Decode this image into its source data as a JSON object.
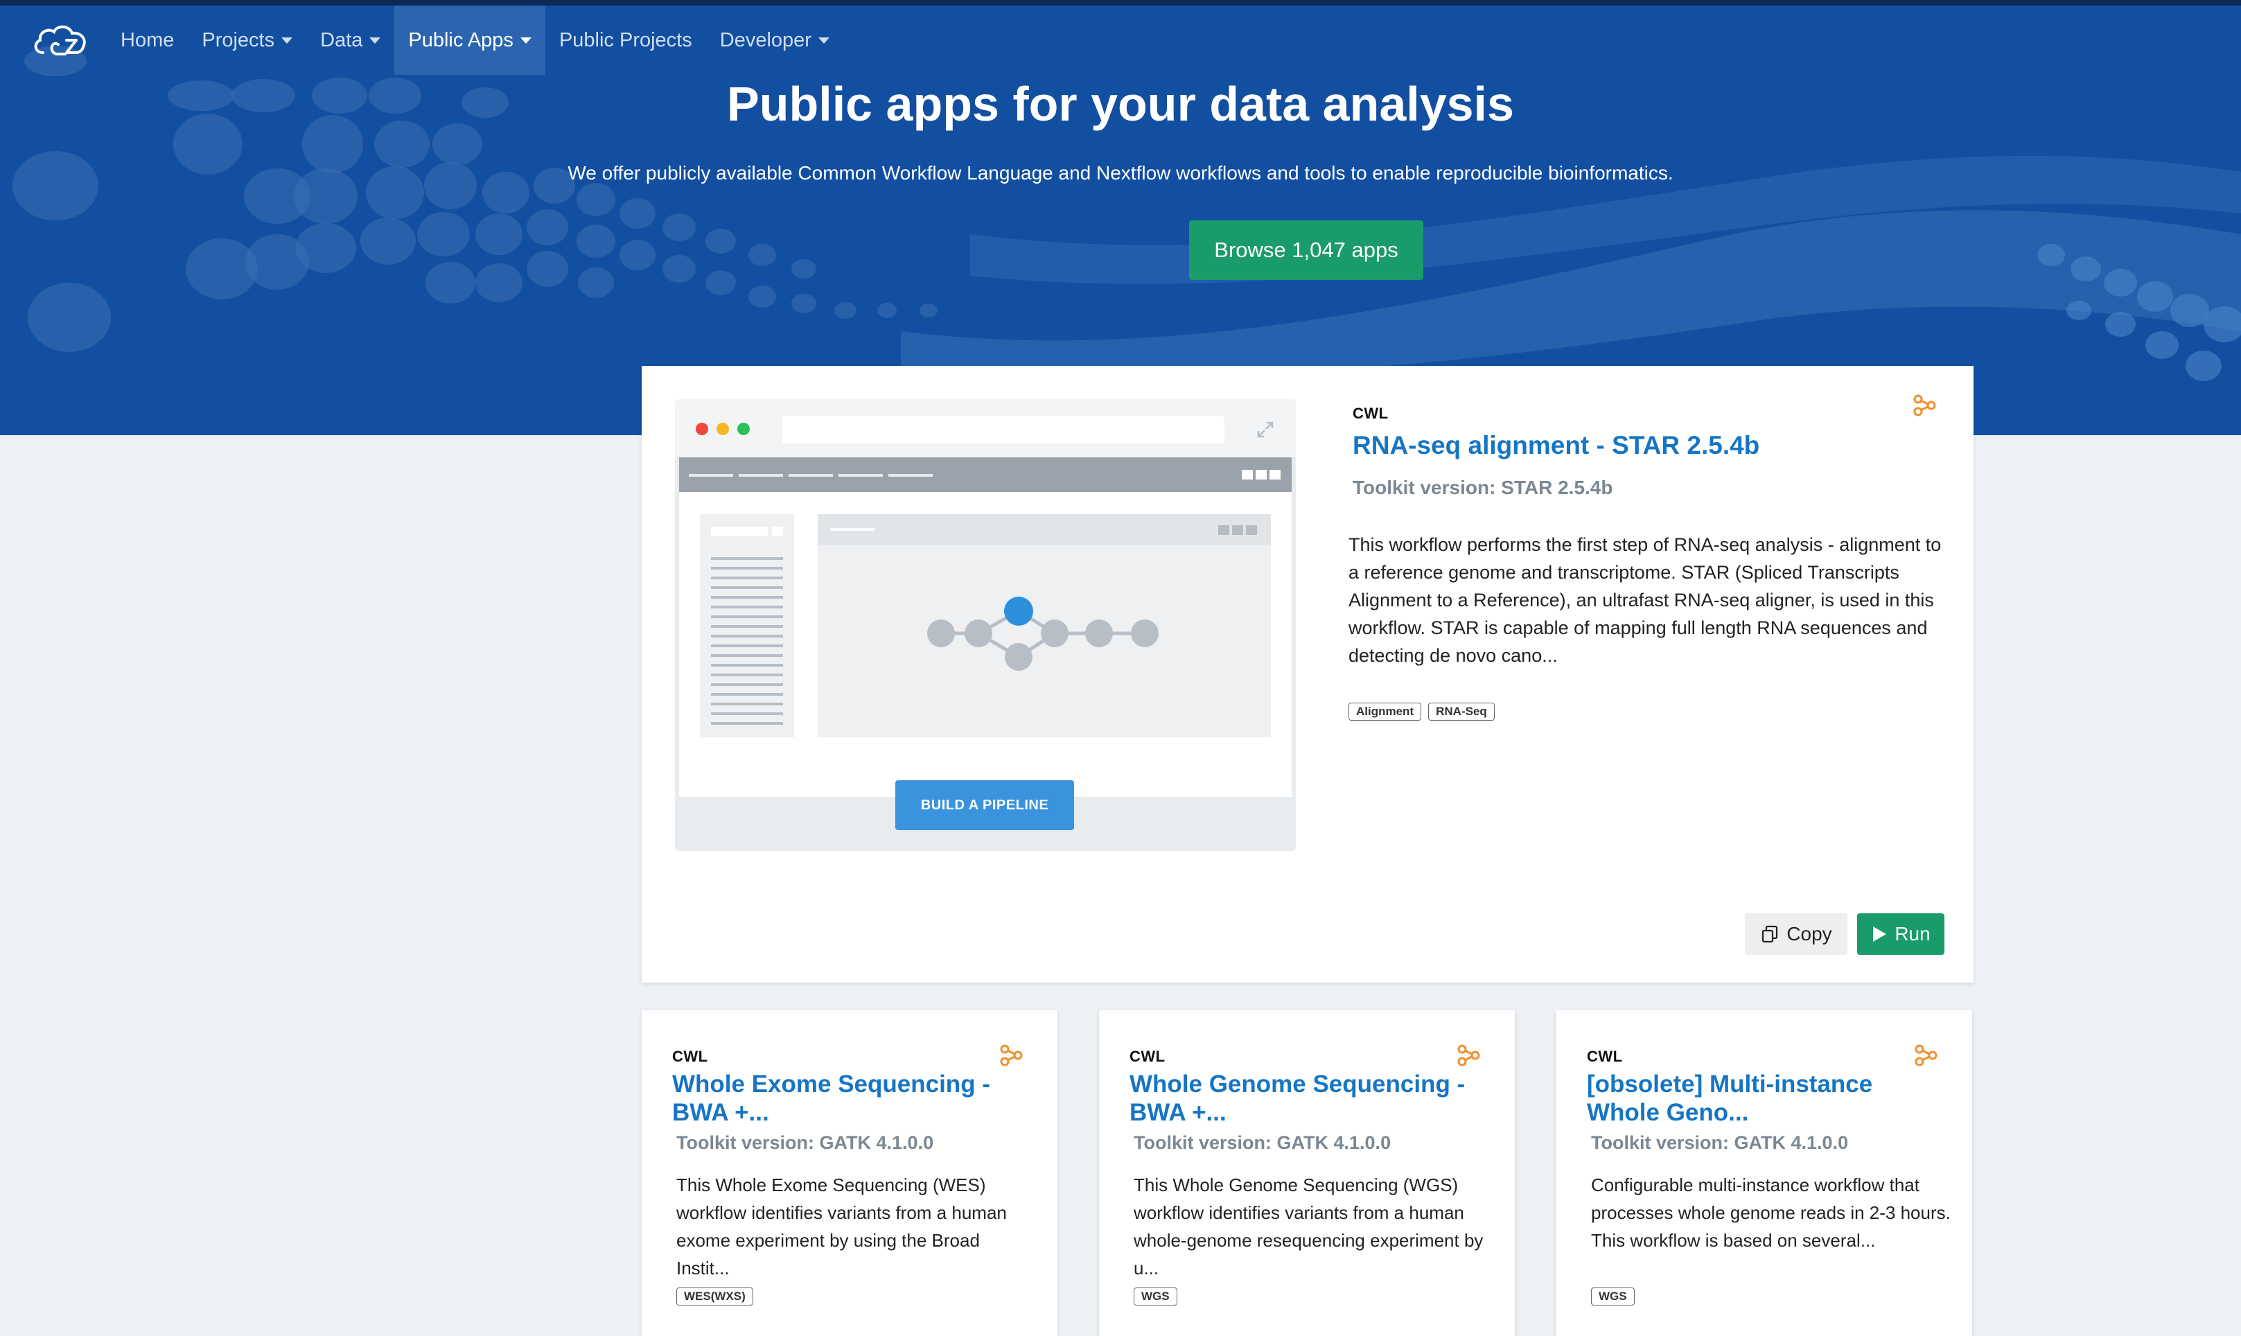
{
  "nav": {
    "items": [
      {
        "label": "Home",
        "dropdown": false
      },
      {
        "label": "Projects",
        "dropdown": true
      },
      {
        "label": "Data",
        "dropdown": true
      },
      {
        "label": "Public Apps",
        "dropdown": true,
        "active": true
      },
      {
        "label": "Public Projects",
        "dropdown": false
      },
      {
        "label": "Developer",
        "dropdown": true
      }
    ],
    "logo_icon": "cloud-logo-icon"
  },
  "hero": {
    "title": "Public apps for your data analysis",
    "subtitle": "We offer publicly available Common Workflow Language and Nextflow workflows and tools to enable reproducible bioinformatics.",
    "browse_label": "Browse 1,047 apps"
  },
  "featured": {
    "illustration_button": "BUILD A PIPELINE",
    "lang": "CWL",
    "title": "RNA-seq alignment - STAR 2.5.4b",
    "toolkit": "Toolkit version: STAR 2.5.4b",
    "description": "This workflow performs the first step of RNA-seq analysis - alignment to a reference genome and transcriptome. STAR (Spliced Transcripts Alignment to a Reference), an ultrafast RNA-seq aligner, is used in this workflow. STAR is capable of mapping full length RNA sequences and detecting de novo cano...",
    "tags": [
      "Alignment",
      "RNA-Seq"
    ],
    "copy_label": "Copy",
    "run_label": "Run"
  },
  "cards": [
    {
      "lang": "CWL",
      "title": "Whole Exome Sequencing - BWA +...",
      "toolkit": "Toolkit version: GATK 4.1.0.0",
      "description": "This Whole Exome Sequencing (WES) workflow identifies variants from a human exome experiment by using the Broad Instit...",
      "tags": [
        "WES(WXS)"
      ]
    },
    {
      "lang": "CWL",
      "title": "Whole Genome Sequencing - BWA +...",
      "toolkit": "Toolkit version: GATK 4.1.0.0",
      "description": "This Whole Genome Sequencing (WGS) workflow identifies variants from a human whole-genome resequencing experiment by u...",
      "tags": [
        "WGS"
      ]
    },
    {
      "lang": "CWL",
      "title": "[obsolete] Multi-instance Whole Geno...",
      "toolkit": "Toolkit version: GATK 4.1.0.0",
      "description": "Configurable multi-instance workflow that processes whole genome reads in 2-3 hours. This workflow is based on several...",
      "tags": [
        "WGS"
      ]
    }
  ],
  "colors": {
    "hero_bg": "#124fa0",
    "nav_active": "#2b65b0",
    "accent_green": "#1a9b6a",
    "link_blue": "#1675c4",
    "fork_orange": "#f0902c",
    "page_bg": "#edf1f5"
  }
}
